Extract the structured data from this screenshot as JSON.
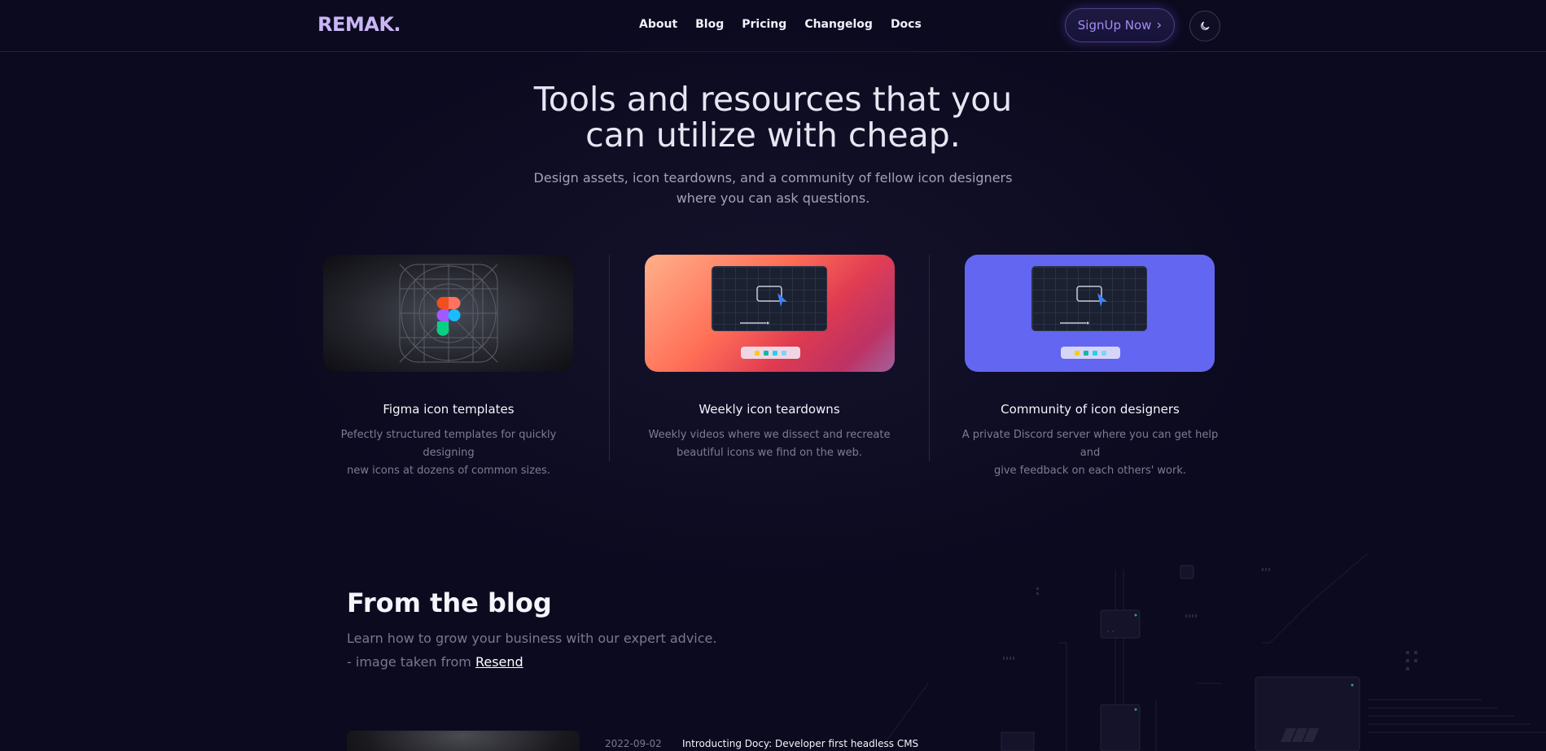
{
  "header": {
    "logo": "REMAK.",
    "nav": [
      "About",
      "Blog",
      "Pricing",
      "Changelog",
      "Docs"
    ],
    "signup_label": "SignUp Now",
    "signup_chevron": "›"
  },
  "hero": {
    "title_line1": "Tools and resources that you",
    "title_line2": "can utilize with cheap.",
    "subtitle_line1": "Design assets, icon teardowns, and a community of fellow icon designers",
    "subtitle_line2": "where you can ask questions."
  },
  "features": [
    {
      "title": "Figma icon templates",
      "desc_line1": "Pefectly structured templates for quickly designing",
      "desc_line2": "new icons at dozens of common sizes."
    },
    {
      "title": "Weekly icon teardowns",
      "desc_line1": "Weekly videos where we dissect and recreate",
      "desc_line2": "beautiful icons we find on the web."
    },
    {
      "title": "Community of icon designers",
      "desc_line1": "A private Discord server where you can get help and",
      "desc_line2": "give feedback on each others' work."
    }
  ],
  "blog": {
    "title": "From the blog",
    "subtitle_part1": "Learn how to grow your business with our expert advice. -",
    "subtitle_part2": "image taken from",
    "link_label": "Resend",
    "posts": [
      {
        "date": "2022-09-02",
        "title": "Introducting Docy: Developer first headless CMS"
      }
    ]
  },
  "icons": {
    "theme_toggle": "moon-icon",
    "figma": "figma-logo-icon",
    "cursor": "cursor-arrow-icon"
  },
  "colors": {
    "background": "#0b0a1f",
    "logo": "#c9b6f5",
    "signup_text": "#a48cf0",
    "card3_bg": "#6366f1"
  }
}
